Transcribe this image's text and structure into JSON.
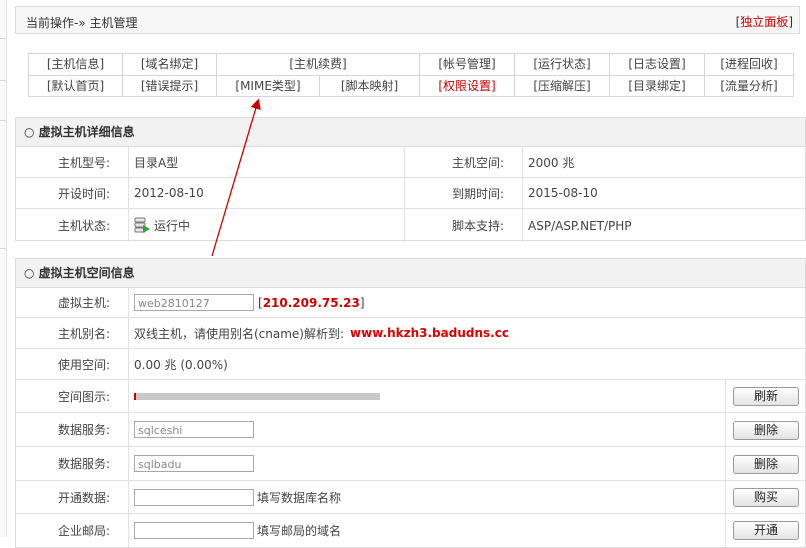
{
  "header": {
    "breadcrumb": "当前操作-» 主机管理",
    "panel_bracket_open": "[",
    "panel_link": "独立面板",
    "panel_bracket_close": "]"
  },
  "nav": {
    "row1": [
      "[主机信息]",
      "[域名绑定]",
      "[主机续费]",
      "[帐号管理]",
      "[运行状态]",
      "[日志设置]",
      "[进程回收]"
    ],
    "row2": [
      "[默认首页]",
      "[错误提示]",
      "[MIME类型]",
      "[脚本映射]",
      "[权限设置]",
      "[压缩解压]",
      "[目录绑定]",
      "[流量分析]"
    ],
    "active_color": "#cc0000"
  },
  "detail": {
    "title": "○ 虚拟主机详细信息",
    "rows": [
      {
        "l1": "主机型号:",
        "v1": "目录A型",
        "l2": "主机空间:",
        "v2": "2000 兆"
      },
      {
        "l1": "开设时间:",
        "v1": "2012-08-10",
        "l2": "到期时间:",
        "v2": "2015-08-10"
      },
      {
        "l1": "主机状态:",
        "v1": "运行中",
        "l2": "脚本支持:",
        "v2": "ASP/ASP.NET/PHP"
      }
    ]
  },
  "space": {
    "title": "○ 虚拟主机空间信息",
    "host_label": "虚拟主机:",
    "host_value": "web2810127",
    "ip_open": "[ ",
    "ip": "210.209.75.23",
    "ip_close": " ]",
    "alias_label": "主机别名:",
    "alias_text": "双线主机，请使用别名(cname)解析到:",
    "alias_domain": "www.hkzh3.badudns.cc",
    "used_label": "使用空间:",
    "used_value": "0.00 兆 (0.00%)",
    "chart_label": "空间图示:",
    "usage_fraction": 0.0,
    "refresh_label": "刷新",
    "db1_label": "数据服务:",
    "db1_value": "sqlceshi",
    "db1_btn": "删除",
    "db2_label": "数据服务:",
    "db2_value": "sqlbadu",
    "db2_btn": "删除",
    "open_db_label": "开通数据:",
    "open_db_hint": "填写数据库名称",
    "buy_label": "购买",
    "mail_label": "企业邮局:",
    "mail_hint": "填写邮局的域名",
    "mail_btn": "开通"
  },
  "colors": {
    "accent_red": "#cc0000",
    "border": "#dcdcdc",
    "header_bg": "#f2f2f2"
  },
  "icons": {
    "status": "server-run-icon",
    "annotation": "red-arrow"
  }
}
